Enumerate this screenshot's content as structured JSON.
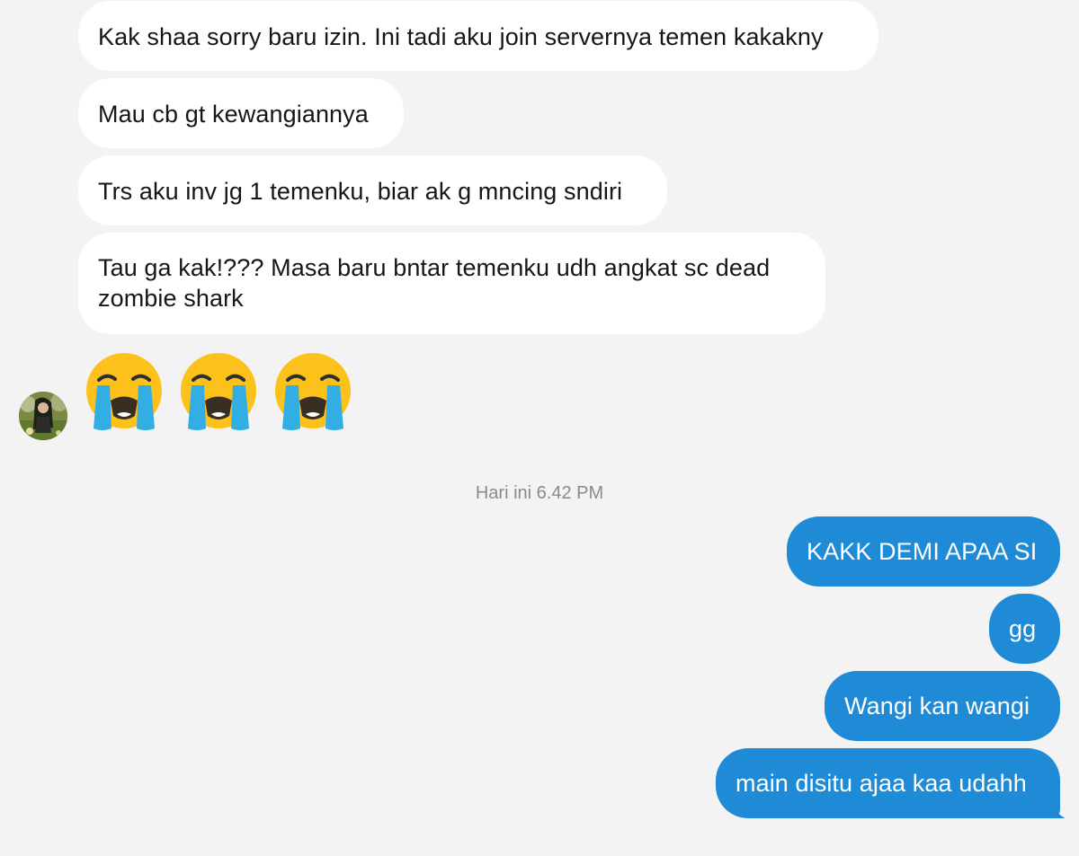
{
  "chat": {
    "incoming": [
      "Kak shaa sorry baru izin. Ini tadi aku join servernya temen kakakny",
      "Mau cb gt kewangiannya",
      "Trs aku inv jg 1 temenku, biar ak g mncing sndiri",
      "Tau ga kak!??? Masa baru bntar temenku udh angkat sc dead zombie shark"
    ],
    "emoji_message": {
      "emojis": [
        "crying-face",
        "crying-face",
        "crying-face"
      ]
    },
    "timestamp": "Hari ini 6.42 PM",
    "outgoing": [
      "KAKK DEMI APAA SI",
      "gg",
      "Wangi kan wangi",
      "main disitu ajaa kaa udahh"
    ]
  },
  "colors": {
    "background": "#f3f3f3",
    "incoming_bubble": "#ffffff",
    "outgoing_bubble": "#1f8ad6",
    "outgoing_text": "#ffffff",
    "timestamp_text": "#8a8a8a"
  }
}
